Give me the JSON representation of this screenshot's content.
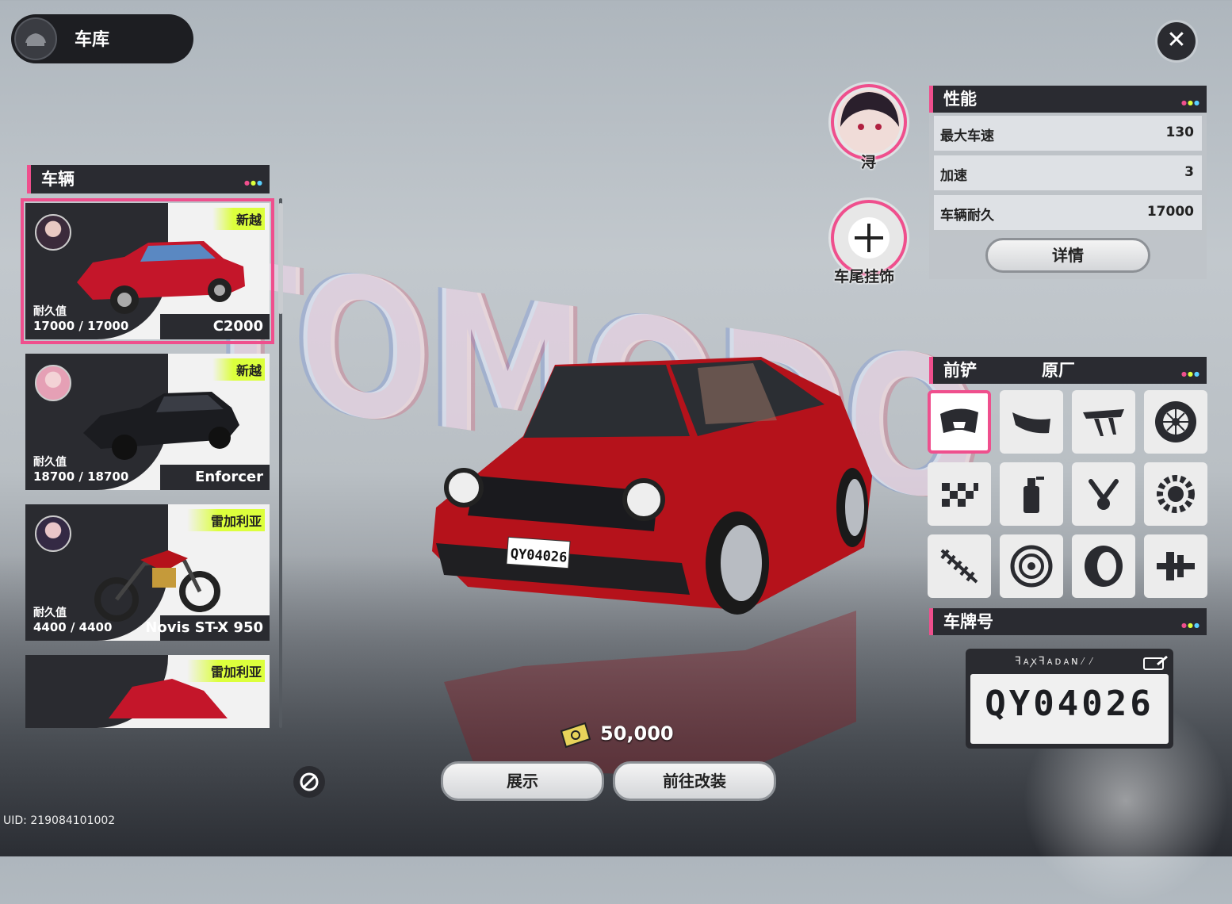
{
  "header": {
    "title": "车库"
  },
  "backdrop_text": "TOMODO",
  "vehicles": {
    "title": "车辆",
    "items": [
      {
        "tag": "新越",
        "durability_label": "耐久值",
        "durability": "17000 / 17000",
        "name": "C2000",
        "selected": true
      },
      {
        "tag": "新越",
        "durability_label": "耐久值",
        "durability": "18700 / 18700",
        "name": "Enforcer",
        "selected": false
      },
      {
        "tag": "雷加利亚",
        "durability_label": "耐久值",
        "durability": "4400 / 4400",
        "name": "Novis ST-X 950",
        "selected": false
      },
      {
        "tag": "雷加利亚",
        "selected": false
      }
    ]
  },
  "driver": {
    "name": "浔"
  },
  "trailer": {
    "label": "车尾挂饰",
    "icon": "plus-icon"
  },
  "performance": {
    "title": "性能",
    "stats": [
      {
        "label": "最大车速",
        "value": "130"
      },
      {
        "label": "加速",
        "value": "3"
      },
      {
        "label": "车辆耐久",
        "value": "17000"
      }
    ],
    "details_button": "详情"
  },
  "parts": {
    "title": "前铲",
    "current": "原厂",
    "icons": [
      "front-bumper-icon",
      "rear-bumper-icon",
      "spoiler-icon",
      "wheel-icon",
      "checkered-flag-icon",
      "spray-can-icon",
      "piston-icon",
      "gear-icon",
      "suspension-spring-icon",
      "brake-disc-icon",
      "tire-icon",
      "transmission-icon"
    ]
  },
  "plate": {
    "title": "车牌号",
    "number": "QY04026"
  },
  "car_plate_text": "QY04026",
  "currency": {
    "amount": "50,000"
  },
  "buttons": {
    "show": "展示",
    "modify": "前往改装"
  },
  "uid": "UID: 219084101002",
  "colors": {
    "accent": "#ef4f8d",
    "panel_dark": "#2a2b31",
    "tag": "#dcff3c",
    "car_red": "#b5121b"
  }
}
